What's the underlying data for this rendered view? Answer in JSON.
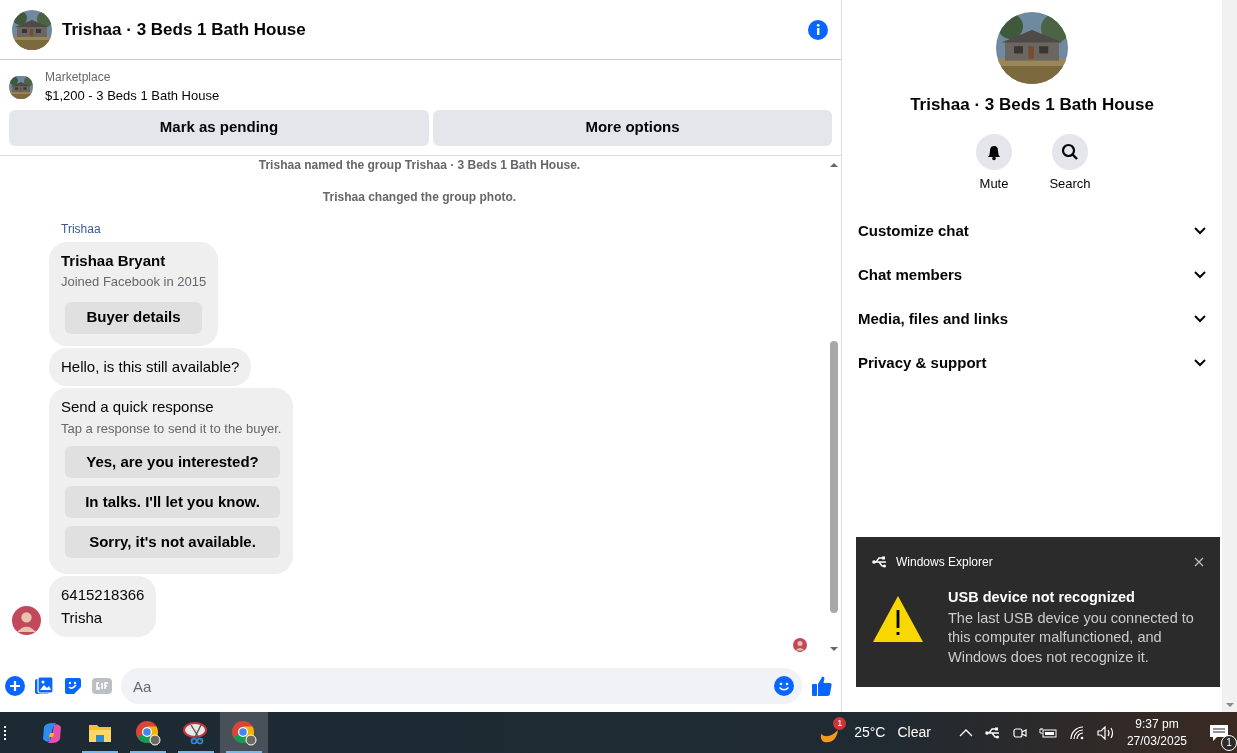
{
  "header": {
    "title": "Trishaa · 3 Beds 1 Bath House"
  },
  "listing": {
    "label": "Marketplace",
    "text": "$1,200 - 3 Beds 1 Bath House"
  },
  "listing_actions": [
    "Mark as pending",
    "More options"
  ],
  "messages": [
    {
      "kind": "system",
      "text": "Trishaa named the group Trishaa · 3 Beds 1 Bath House."
    },
    {
      "kind": "system",
      "text": "Trishaa changed the group photo."
    },
    {
      "kind": "sender",
      "text": "Trishaa"
    },
    {
      "kind": "profile",
      "name": "Trishaa Bryant",
      "detail": "Joined Facebook in 2015",
      "button": "Buyer details"
    },
    {
      "kind": "text",
      "lines": [
        "Hello, is this still available?"
      ]
    },
    {
      "kind": "quick",
      "title": "Send a quick response",
      "hint": "Tap a response to send it to the buyer.",
      "options": [
        "Yes, are you interested?",
        "In talks. I'll let you know.",
        "Sorry, it's not available."
      ]
    },
    {
      "kind": "text",
      "lines": [
        "6415218366",
        "Trisha"
      ],
      "avatar": true
    }
  ],
  "composer": {
    "placeholder": "Aa"
  },
  "details": {
    "title": "Trishaa · 3 Beds 1 Bath House",
    "actions": [
      {
        "kind": "bell",
        "label": "Mute"
      },
      {
        "kind": "search",
        "label": "Search"
      }
    ],
    "sections": [
      "Customize chat",
      "Chat members",
      "Media, files and links",
      "Privacy & support"
    ]
  },
  "toast": {
    "app": "Windows Explorer",
    "title": "USB device not recognized",
    "body": "The last USB device you connected to this computer malfunctioned, and Windows does not recognize it."
  },
  "taskbar": {
    "apps": [
      {
        "kind": "copilot",
        "active": false,
        "selected": false
      },
      {
        "kind": "folder",
        "active": true,
        "selected": false
      },
      {
        "kind": "chrome",
        "active": true,
        "selected": false
      },
      {
        "kind": "snip",
        "active": true,
        "selected": false
      },
      {
        "kind": "chrome",
        "active": true,
        "selected": true
      }
    ],
    "weather_badge": "1",
    "temperature": "25°C",
    "condition": "Clear",
    "time": "9:37 pm",
    "date": "27/03/2025",
    "notifications": "1"
  }
}
